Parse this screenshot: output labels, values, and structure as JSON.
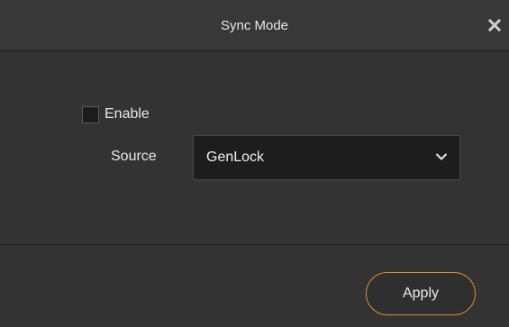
{
  "dialog": {
    "title": "Sync Mode",
    "close_icon": "close-icon"
  },
  "form": {
    "enable_label": "Enable",
    "enable_checked": false,
    "source_label": "Source",
    "source_value": "GenLock",
    "source_dropdown_icon": "chevron-down-icon"
  },
  "footer": {
    "apply_label": "Apply"
  },
  "colors": {
    "background": "#333333",
    "title_bar": "#383838",
    "select_bg": "#1d1d1d",
    "accent_border": "#e08a2c",
    "text": "#e8e8e8"
  }
}
